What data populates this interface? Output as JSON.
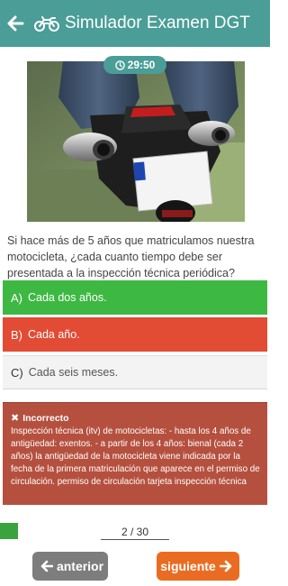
{
  "header": {
    "title": "Simulador Examen DGT",
    "back_icon": "arrow-left-icon",
    "app_icon": "motorcycle-icon",
    "color": "#4a9e97"
  },
  "timer": {
    "icon": "clock-icon",
    "value": "29:50"
  },
  "question": {
    "text": "Si hace más de 5 años que matriculamos nuestra motocicleta, ¿cada cuanto tiempo debe ser presentada a la inspección técnica periódica?"
  },
  "options": [
    {
      "letter": "A)",
      "text": "Cada dos años.",
      "state": "correct",
      "color": "#3db843"
    },
    {
      "letter": "B)",
      "text": "Cada año.",
      "state": "incorrect-selected",
      "color": "#e24b34"
    },
    {
      "letter": "C)",
      "text": "Cada seis meses.",
      "state": "neutral",
      "color": "#f3f3f3"
    }
  ],
  "explanation": {
    "icon": "close-icon",
    "title": "Incorrecto",
    "text": "Inspección técnica (itv) de motocicletas: - hasta los 4 años de antigüedad: exentos. - a partir de los 4 años: bienal (cada 2 años) la antigüedad de la motocicleta viene indicada por la fecha de la primera matriculación que aparece en el permiso de circulación. permiso de circulación tarjeta inspección técnica",
    "color": "#b5503f"
  },
  "progress": {
    "current": 2,
    "total": 30,
    "label": "2 / 30",
    "fraction": 0.0667
  },
  "nav": {
    "prev_label": "anterior",
    "prev_icon": "arrow-left-icon",
    "next_label": "siguiente",
    "next_icon": "arrow-right-icon",
    "prev_color": "#7d7d7d",
    "next_color": "#ea6c22"
  }
}
